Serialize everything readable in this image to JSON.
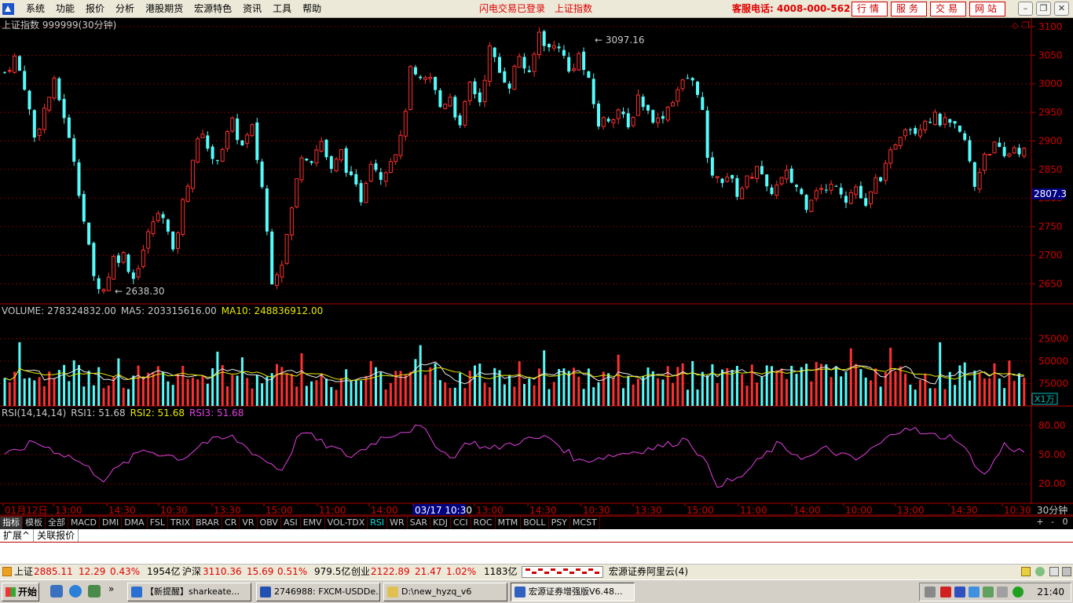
{
  "menu": {
    "items": [
      "系统",
      "功能",
      "报价",
      "分析",
      "港股期货",
      "宏源特色",
      "资讯",
      "工具",
      "帮助"
    ],
    "login_status": "闪电交易已登录",
    "current_index": "上证指数",
    "hotline": "客服电话: 4008-000-562",
    "quick_links": [
      "行情",
      "服务",
      "交易",
      "网站"
    ],
    "window_buttons": [
      "minimize",
      "restore",
      "close"
    ]
  },
  "price_panel": {
    "title": "上证指数  999999(30分钟)",
    "high_label": "3097.16",
    "low_label": "2638.30",
    "current_price": "2807.3",
    "y_ticks": [
      "3100",
      "3050",
      "3000",
      "2950",
      "2900",
      "2850",
      "2800",
      "2750",
      "2700",
      "2650"
    ],
    "panel_icons": [
      "diamond-icon",
      "copy-icon"
    ]
  },
  "volume_panel": {
    "label_volume": "VOLUME: 278324832.00",
    "label_ma5": "MA5: 203315616.00",
    "label_ma10": "MA10: 248836912.00",
    "y_ticks": [
      "75000",
      "50000",
      "25000"
    ],
    "unit": "X1万"
  },
  "rsi_panel": {
    "label_params": "RSI(14,14,14)",
    "label_rsi1": "RSI1: 51.68",
    "label_rsi2": "RSI2: 51.68",
    "label_rsi3": "RSI3: 51.68",
    "y_ticks": [
      "80.00",
      "50.00",
      "20.00"
    ]
  },
  "time_axis": {
    "labels": [
      "01月12日",
      "13:00",
      "14:30",
      "10:30",
      "13:30",
      "15:00",
      "11:00",
      "14:00",
      "03/17 10:30",
      "13:00",
      "14:30",
      "10:30",
      "13:30",
      "15:00",
      "11:00",
      "14:00",
      "10:00",
      "13:00",
      "14:30",
      "10:30"
    ],
    "period": "30分钟"
  },
  "indicator_tabs": [
    "指标",
    "模板",
    "全部",
    "MACD",
    "DMI",
    "DMA",
    "FSL",
    "TRIX",
    "BRAR",
    "CR",
    "VR",
    "OBV",
    "ASI",
    "EMV",
    "VOL-TDX",
    "RSI",
    "WR",
    "SAR",
    "KDJ",
    "CCI",
    "ROC",
    "MTM",
    "BOLL",
    "PSY",
    "MCST"
  ],
  "page_buttons": [
    "+",
    "-",
    "0"
  ],
  "extension_tabs": [
    "扩展^",
    "关联报价"
  ],
  "status_bar": {
    "sh_name": "上证",
    "sh_value": "2885.11",
    "sh_change": "12.29",
    "sh_pct": "0.43%",
    "sh_amount": "1954亿",
    "hs_name": "沪深",
    "hs_value": "3110.36",
    "hs_change": "15.69",
    "hs_pct": "0.51%",
    "hs_amount": "979.5亿",
    "cy_name": "创业",
    "cy_value": "2122.89",
    "cy_change": "21.47",
    "cy_pct": "1.02%",
    "cy_amount": "1183亿",
    "server": "宏源证券阿里云(4)"
  },
  "taskbar": {
    "start_label": "开始",
    "tasks": [
      "【新提醒】sharkeate...",
      "2746988: FXCM-USDDe...",
      "D:\\new_hyzq_v6",
      "宏源证券增强版V6.48..."
    ],
    "clock": "21:40"
  },
  "chart_data": {
    "type": "candlestick",
    "instrument": "上证指数 999999",
    "period": "30分钟",
    "price_range": [
      2615,
      3115
    ],
    "high": 3097.16,
    "low": 2638.3,
    "last": 2807.3,
    "close_path": [
      [
        0,
        3020
      ],
      [
        2,
        3045
      ],
      [
        4,
        2998
      ],
      [
        6,
        2905
      ],
      [
        8,
        2955
      ],
      [
        10,
        3000
      ],
      [
        12,
        2945
      ],
      [
        13,
        2900
      ],
      [
        14,
        2870
      ],
      [
        16,
        2760
      ],
      [
        18,
        2660
      ],
      [
        20,
        2640
      ],
      [
        22,
        2695
      ],
      [
        24,
        2700
      ],
      [
        26,
        2660
      ],
      [
        28,
        2710
      ],
      [
        30,
        2760
      ],
      [
        32,
        2775
      ],
      [
        34,
        2700
      ],
      [
        36,
        2790
      ],
      [
        38,
        2870
      ],
      [
        40,
        2920
      ],
      [
        42,
        2860
      ],
      [
        44,
        2890
      ],
      [
        46,
        2930
      ],
      [
        48,
        2890
      ],
      [
        50,
        2920
      ],
      [
        52,
        2820
      ],
      [
        54,
        2660
      ],
      [
        56,
        2690
      ],
      [
        58,
        2780
      ],
      [
        60,
        2880
      ],
      [
        62,
        2870
      ],
      [
        64,
        2900
      ],
      [
        66,
        2845
      ],
      [
        68,
        2880
      ],
      [
        70,
        2830
      ],
      [
        72,
        2800
      ],
      [
        74,
        2870
      ],
      [
        76,
        2840
      ],
      [
        78,
        2870
      ],
      [
        80,
        2900
      ],
      [
        82,
        3020
      ],
      [
        84,
        3000
      ],
      [
        86,
        3010
      ],
      [
        88,
        2960
      ],
      [
        90,
        2980
      ],
      [
        92,
        2920
      ],
      [
        94,
        3000
      ],
      [
        96,
        2970
      ],
      [
        98,
        3060
      ],
      [
        100,
        3020
      ],
      [
        102,
        3000
      ],
      [
        104,
        3050
      ],
      [
        106,
        3010
      ],
      [
        108,
        3090
      ],
      [
        110,
        3060
      ],
      [
        112,
        3070
      ],
      [
        114,
        3020
      ],
      [
        116,
        3050
      ],
      [
        118,
        3000
      ],
      [
        120,
        2930
      ],
      [
        122,
        2940
      ],
      [
        124,
        2955
      ],
      [
        126,
        2920
      ],
      [
        128,
        2980
      ],
      [
        130,
        2950
      ],
      [
        132,
        2935
      ],
      [
        134,
        2960
      ],
      [
        136,
        2990
      ],
      [
        138,
        3010
      ],
      [
        140,
        2990
      ],
      [
        141,
        2950
      ],
      [
        142,
        2860
      ],
      [
        144,
        2830
      ],
      [
        146,
        2840
      ],
      [
        148,
        2810
      ],
      [
        150,
        2830
      ],
      [
        152,
        2860
      ],
      [
        154,
        2810
      ],
      [
        156,
        2820
      ],
      [
        158,
        2840
      ],
      [
        160,
        2820
      ],
      [
        162,
        2790
      ],
      [
        164,
        2820
      ],
      [
        166,
        2810
      ],
      [
        168,
        2830
      ],
      [
        170,
        2800
      ],
      [
        172,
        2820
      ],
      [
        174,
        2780
      ],
      [
        176,
        2830
      ],
      [
        178,
        2850
      ],
      [
        180,
        2900
      ],
      [
        182,
        2930
      ],
      [
        184,
        2920
      ],
      [
        186,
        2940
      ],
      [
        188,
        2940
      ],
      [
        190,
        2930
      ],
      [
        192,
        2920
      ],
      [
        194,
        2900
      ],
      [
        196,
        2820
      ],
      [
        198,
        2880
      ],
      [
        200,
        2890
      ],
      [
        202,
        2870
      ],
      [
        204,
        2890
      ],
      [
        206,
        2880
      ]
    ],
    "rsi_path": [
      [
        0,
        48
      ],
      [
        6,
        63
      ],
      [
        14,
        46
      ],
      [
        20,
        25
      ],
      [
        28,
        55
      ],
      [
        36,
        46
      ],
      [
        40,
        62
      ],
      [
        46,
        68
      ],
      [
        52,
        46
      ],
      [
        56,
        34
      ],
      [
        60,
        75
      ],
      [
        64,
        62
      ],
      [
        70,
        48
      ],
      [
        76,
        67
      ],
      [
        80,
        74
      ],
      [
        84,
        78
      ],
      [
        90,
        46
      ],
      [
        94,
        64
      ],
      [
        98,
        55
      ],
      [
        104,
        64
      ],
      [
        110,
        68
      ],
      [
        116,
        43
      ],
      [
        120,
        47
      ],
      [
        128,
        54
      ],
      [
        134,
        60
      ],
      [
        138,
        67
      ],
      [
        141,
        46
      ],
      [
        144,
        20
      ],
      [
        148,
        24
      ],
      [
        152,
        42
      ],
      [
        156,
        60
      ],
      [
        162,
        46
      ],
      [
        166,
        56
      ],
      [
        172,
        44
      ],
      [
        178,
        65
      ],
      [
        182,
        80
      ],
      [
        186,
        70
      ],
      [
        192,
        68
      ],
      [
        196,
        42
      ],
      [
        198,
        28
      ],
      [
        202,
        60
      ],
      [
        206,
        52
      ]
    ],
    "rsi_range": [
      0,
      100
    ],
    "volume_range": [
      0,
      100000
    ],
    "volume_ticks": [
      25000,
      50000,
      75000
    ]
  }
}
